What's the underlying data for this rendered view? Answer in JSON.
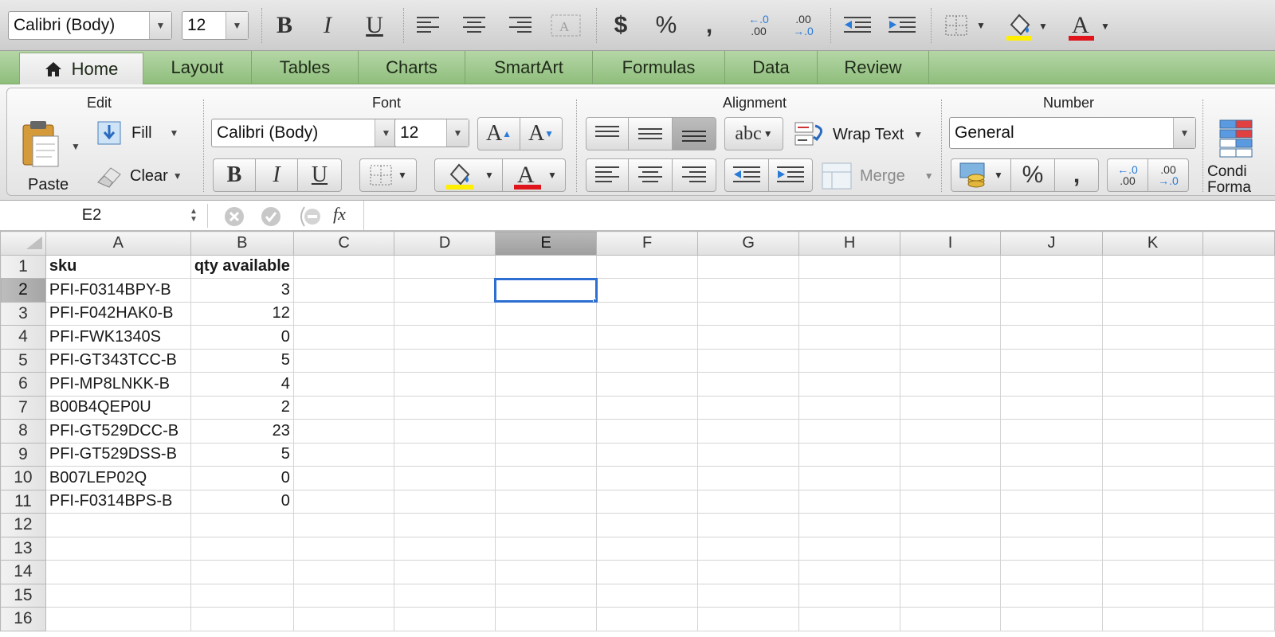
{
  "formatting_bar": {
    "font_name": "Calibri (Body)",
    "font_size": "12",
    "bold": "B",
    "italic": "I",
    "underline": "U",
    "currency": "$",
    "percent": "%",
    "comma": ",",
    "inc_decimal_top": "←.0",
    "inc_decimal_bottom": ".00",
    "dec_decimal_top": ".00",
    "dec_decimal_bottom": "→.0"
  },
  "tabs": [
    {
      "label": "Home"
    },
    {
      "label": "Layout"
    },
    {
      "label": "Tables"
    },
    {
      "label": "Charts"
    },
    {
      "label": "SmartArt"
    },
    {
      "label": "Formulas"
    },
    {
      "label": "Data"
    },
    {
      "label": "Review"
    }
  ],
  "ribbon": {
    "edit": {
      "label": "Edit",
      "paste": "Paste",
      "fill": "Fill",
      "clear": "Clear"
    },
    "font": {
      "label": "Font",
      "font_name": "Calibri (Body)",
      "font_size": "12",
      "grow": "A",
      "shrink": "A",
      "bold": "B",
      "italic": "I",
      "underline": "U",
      "color_letter": "A"
    },
    "alignment": {
      "label": "Alignment",
      "orientation": "abc",
      "wrap_text": "Wrap Text",
      "merge": "Merge"
    },
    "number": {
      "label": "Number",
      "format": "General",
      "percent": "%",
      "comma": ",",
      "inc_top": "←.0",
      "inc_bottom": ".00",
      "dec_top": ".00",
      "dec_bottom": "→.0"
    },
    "format": {
      "label_1": "Condi",
      "label_2": "Forma"
    }
  },
  "formula_bar": {
    "name_box": "E2",
    "fx": "fx",
    "formula": ""
  },
  "sheet": {
    "columns": [
      "A",
      "B",
      "C",
      "D",
      "E",
      "F",
      "G",
      "H",
      "I",
      "J",
      "K"
    ],
    "selected_column": "E",
    "selected_row": 2,
    "rows": [
      {
        "num": "1",
        "a": "sku",
        "b": "qty available"
      },
      {
        "num": "2",
        "a": "PFI-F0314BPY-B",
        "b": "3"
      },
      {
        "num": "3",
        "a": "PFI-F042HAK0-B",
        "b": "12"
      },
      {
        "num": "4",
        "a": "PFI-FWK1340S",
        "b": "0"
      },
      {
        "num": "5",
        "a": "PFI-GT343TCC-B",
        "b": "5"
      },
      {
        "num": "6",
        "a": "PFI-MP8LNKK-B",
        "b": "4"
      },
      {
        "num": "7",
        "a": "B00B4QEP0U",
        "b": "2"
      },
      {
        "num": "8",
        "a": "PFI-GT529DCC-B",
        "b": "23"
      },
      {
        "num": "9",
        "a": "PFI-GT529DSS-B",
        "b": "5"
      },
      {
        "num": "10",
        "a": "B007LEP02Q",
        "b": "0"
      },
      {
        "num": "11",
        "a": "PFI-F0314BPS-B",
        "b": "0"
      },
      {
        "num": "12",
        "a": "",
        "b": ""
      },
      {
        "num": "13",
        "a": "",
        "b": ""
      },
      {
        "num": "14",
        "a": "",
        "b": ""
      },
      {
        "num": "15",
        "a": "",
        "b": ""
      },
      {
        "num": "16",
        "a": "",
        "b": ""
      }
    ]
  },
  "colors": {
    "highlight_fill": "#ffee00",
    "font_color": "#e0141b",
    "selection": "#2d6fd1",
    "tab_bar": "#9ec78c"
  }
}
